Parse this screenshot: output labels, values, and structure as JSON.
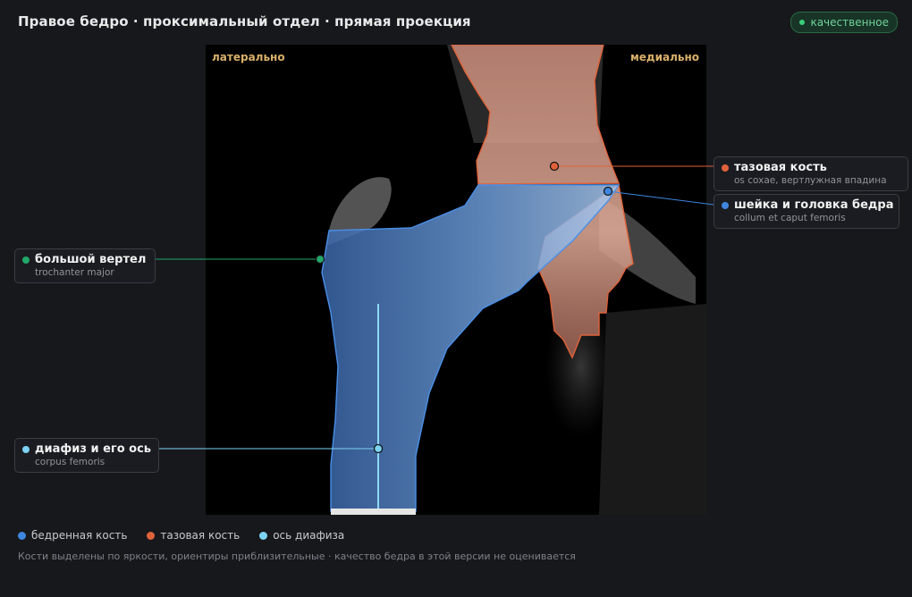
{
  "header": {
    "title": "Правое бедро · проксимальный отдел · прямая проекция",
    "badge": "качественное"
  },
  "viewer": {
    "orientation_left": "латерально",
    "orientation_right": "медиально"
  },
  "callouts": {
    "pelvis": {
      "title": "тазовая кость",
      "subtitle": "os coxae, вертлужная впадина",
      "color": "#e0623a"
    },
    "neck": {
      "title": "шейка и головка бедра",
      "subtitle": "collum et caput femoris",
      "color": "#3f86e0"
    },
    "trochanter": {
      "title": "большой вертел",
      "subtitle": "trochanter major",
      "color": "#22a86b"
    },
    "shaft": {
      "title": "диафиз и его ось",
      "subtitle": "corpus femoris",
      "color": "#7dd3f3"
    }
  },
  "legend": [
    {
      "label": "бедренная кость",
      "color": "#3f86e0"
    },
    {
      "label": "тазовая кость",
      "color": "#e0623a"
    },
    {
      "label": "ось диафиза",
      "color": "#7dd3f3"
    }
  ],
  "footnote": "Кости выделены по яркости, ориентиры приблизительные · качество бедра в этой версии не оценивается"
}
